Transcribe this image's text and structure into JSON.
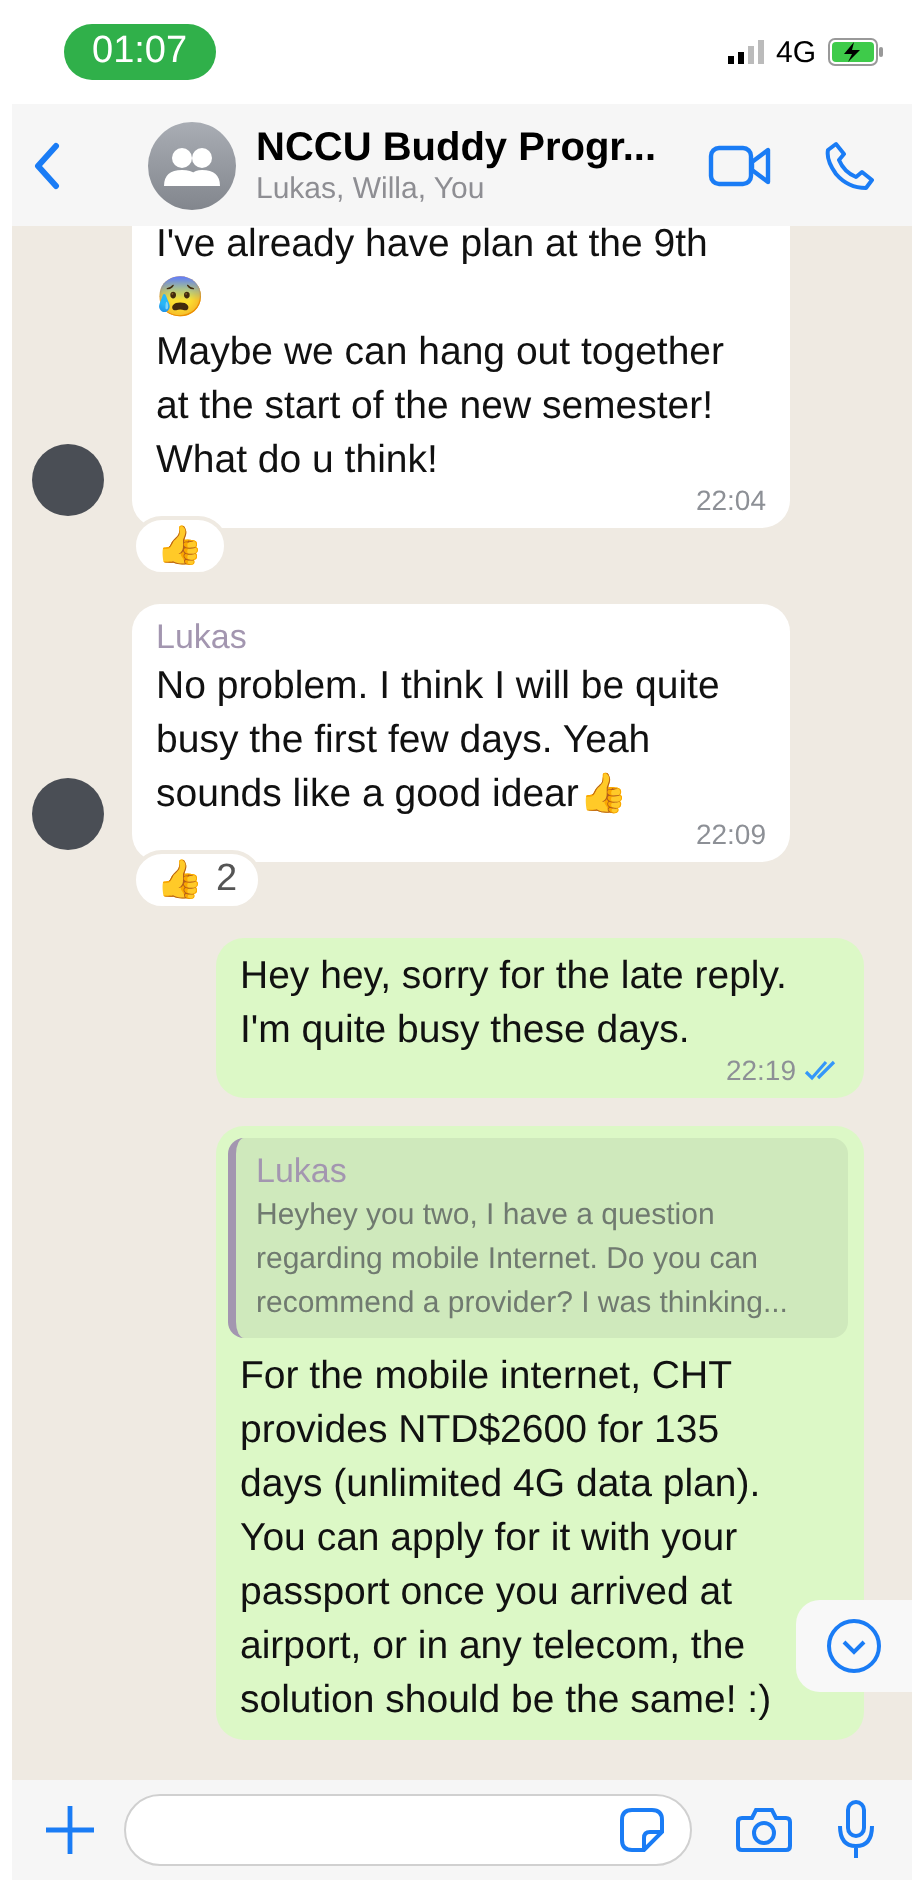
{
  "status_bar": {
    "time": "01:07",
    "network": "4G"
  },
  "header": {
    "title": "NCCU Buddy Progr...",
    "subtitle": "Lukas, Willa, You"
  },
  "messages": [
    {
      "kind": "incoming",
      "avatar": true,
      "text": "I've already have plan at the 9th\n😰\nMaybe we can hang out together\nat the start of the new semester!\nWhat do u think!",
      "time": "22:04",
      "reaction": {
        "emoji": "👍"
      }
    },
    {
      "kind": "incoming",
      "avatar": true,
      "sender": "Lukas",
      "text": "No problem. I think I will be quite\nbusy the first few days. Yeah\nsounds like a good idear👍",
      "time": "22:09",
      "reaction": {
        "emoji": "👍",
        "count": "2"
      }
    },
    {
      "kind": "outgoing",
      "text": "Hey hey, sorry for the late reply.\nI'm quite busy these days.",
      "time": "22:19",
      "read": true
    },
    {
      "kind": "outgoing",
      "quote": {
        "sender": "Lukas",
        "text": "Heyhey you two, I have a question\nregarding mobile Internet. Do you can\nrecommend a provider? I was thinking..."
      },
      "text": "For the mobile internet, CHT\nprovides NTD$2600 for 135\ndays (unlimited 4G data plan).\nYou can apply for it with your\npassport once you arrived at\nairport, or in any telecom, the\nsolution should be the same! :)"
    }
  ],
  "composer": {
    "scroll_down": true
  }
}
